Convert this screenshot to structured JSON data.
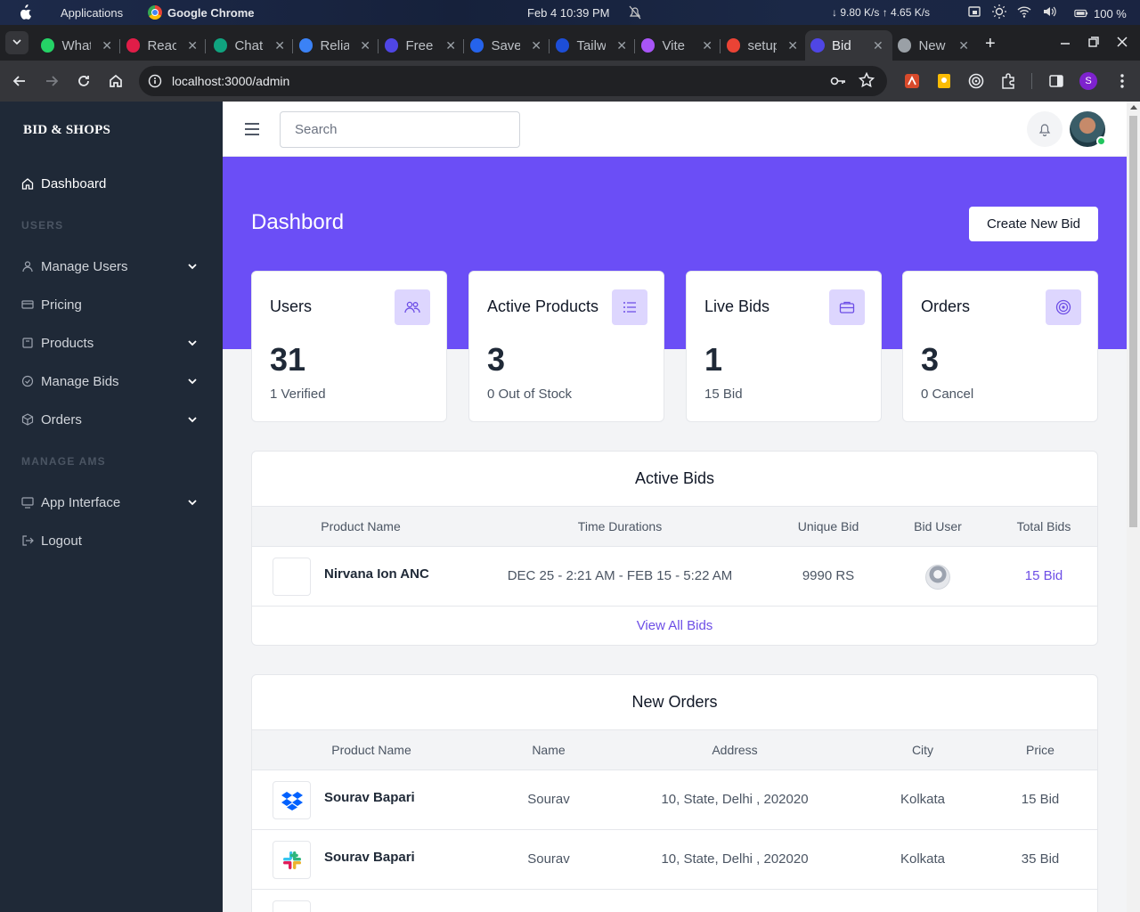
{
  "os": {
    "apps_label": "Applications",
    "browser_label": "Google Chrome",
    "datetime": "Feb 4  10:39 PM",
    "network": "↓ 9.80 K/s ↑ 4.65 K/s",
    "battery": "100 %"
  },
  "tabs": [
    {
      "label": "WhatsApp",
      "color": "#25d366"
    },
    {
      "label": "React",
      "color": "#e11d48"
    },
    {
      "label": "ChatGPT",
      "color": "#10a37f"
    },
    {
      "label": "Reliable",
      "color": "#3b82f6"
    },
    {
      "label": "Free",
      "color": "#4f46e5"
    },
    {
      "label": "Save",
      "color": "#2563eb"
    },
    {
      "label": "Tailwind",
      "color": "#1d4ed8"
    },
    {
      "label": "Vite",
      "color": "#a855f7"
    },
    {
      "label": "setup",
      "color": "#ea4335"
    },
    {
      "label": "Bid",
      "color": "#4f46e5",
      "active": true
    },
    {
      "label": "New",
      "color": "#9aa0a6"
    }
  ],
  "browser": {
    "url": "localhost:3000/admin",
    "profile_initial": "S"
  },
  "sidebar": {
    "brand": "BID & SHOPS",
    "items": [
      {
        "label": "Dashboard"
      },
      {
        "label": "USERS"
      },
      {
        "label": "Manage Users"
      },
      {
        "label": "Pricing"
      },
      {
        "label": "Products"
      },
      {
        "label": "Manage Bids"
      },
      {
        "label": "Orders"
      },
      {
        "label": "MANAGE AMS"
      },
      {
        "label": "App Interface"
      },
      {
        "label": "Logout"
      }
    ]
  },
  "header": {
    "search_placeholder": "Search"
  },
  "main": {
    "title": "Dashbord",
    "create_button": "Create New Bid",
    "accent_color": "#6b4ef6",
    "cards": [
      {
        "title": "Users",
        "value": "31",
        "sub": "1 Verified"
      },
      {
        "title": "Active Products",
        "value": "3",
        "sub": "0 Out of Stock"
      },
      {
        "title": "Live Bids",
        "value": "1",
        "sub": "15 Bid"
      },
      {
        "title": "Orders",
        "value": "3",
        "sub": "0 Cancel"
      }
    ]
  },
  "active_bids": {
    "title": "Active Bids",
    "columns": [
      "Product Name",
      "Time Durations",
      "Unique Bid",
      "Bid User",
      "Total Bids"
    ],
    "rows": [
      {
        "product": "Nirvana Ion ANC",
        "duration": "DEC 25 - 2:21 AM - FEB 15 - 5:22 AM",
        "unique_bid": "9990 RS",
        "total": "15 Bid"
      }
    ],
    "view_all": "View All Bids"
  },
  "new_orders": {
    "title": "New Orders",
    "columns": [
      "Product Name",
      "Name",
      "Address",
      "City",
      "Price"
    ],
    "rows": [
      {
        "product": "Sourav Bapari",
        "name": "Sourav",
        "address": "10, State, Delhi , 202020",
        "city": "Kolkata",
        "price": "15 Bid",
        "icon": "dropbox-icon"
      },
      {
        "product": "Sourav Bapari",
        "name": "Sourav",
        "address": "10, State, Delhi , 202020",
        "city": "Kolkata",
        "price": "35 Bid",
        "icon": "slack-icon"
      }
    ]
  }
}
